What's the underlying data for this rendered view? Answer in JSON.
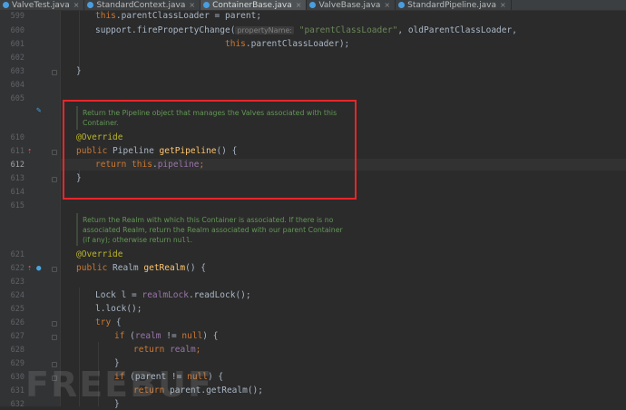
{
  "tabs": [
    {
      "label": "ValveTest.java",
      "active": false,
      "icon_color": "#4a9ede"
    },
    {
      "label": "StandardContext.java",
      "active": false,
      "icon_color": "#4a9ede"
    },
    {
      "label": "ContainerBase.java",
      "active": true,
      "icon_color": "#4a9ede"
    },
    {
      "label": "ValveBase.java",
      "active": false,
      "icon_color": "#4a9ede"
    },
    {
      "label": "StandardPipeline.java",
      "active": false,
      "icon_color": "#4a9ede"
    }
  ],
  "line_numbers": {
    "l599": "599",
    "l600": "600",
    "l601": "601",
    "l602": "602",
    "l603": "603",
    "l604": "604",
    "l605": "605",
    "l610": "610",
    "l611": "611",
    "l612": "612",
    "l613": "613",
    "l614": "614",
    "l615": "615",
    "l621": "621",
    "l622": "622",
    "l623": "623",
    "l624": "624",
    "l625": "625",
    "l626": "626",
    "l627": "627",
    "l628": "628",
    "l629": "629",
    "l630": "630",
    "l631": "631",
    "l632": "632"
  },
  "code": {
    "line599": {
      "this": "this",
      "rest": ".parentClassLoader = parent;"
    },
    "line600": {
      "pre": "support.firePropertyChange(",
      "hint": "propertyName:",
      "str": "\"parentClassLoader\"",
      "post": ", oldParentClassLoader,"
    },
    "line601": {
      "this": "this",
      "rest": ".parentClassLoader);"
    },
    "line603": "}",
    "doc1": "Return the Pipeline object that manages the Valves associated with this Container.",
    "line610": "@Override",
    "line611": {
      "kw": "public",
      "type": " Pipeline ",
      "fn": "getPipeline",
      "rest": "() {"
    },
    "line612": {
      "kw1": "return",
      "kw2": "this",
      "dot": ".",
      "fld": "pipeline",
      "end": ";"
    },
    "line613": "}",
    "doc2": "Return the Realm with which this Container is associated. If there is no associated Realm, return the Realm associated with our parent Container (if any); otherwise return",
    "doc2_code": "null",
    "doc2_end": ".",
    "line621": "@Override",
    "line622": {
      "kw": "public",
      "type": " Realm ",
      "fn": "getRealm",
      "rest": "() {"
    },
    "line624": {
      "pre": "Lock l = ",
      "fld": "realmLock",
      "post": ".readLock();"
    },
    "line625": "l.lock();",
    "line626": {
      "kw": "try",
      "rest": " {"
    },
    "line627": {
      "kw": "if",
      "pre": " (",
      "fld": "realm",
      "mid": " != ",
      "kw2": "null",
      "post": ") {"
    },
    "line628": {
      "kw": "return",
      "fld": "realm",
      "end": ";"
    },
    "line629": "}",
    "line630": {
      "kw": "if",
      "pre": " (parent != ",
      "kw2": "null",
      "post": ") {"
    },
    "line631": {
      "kw": "return",
      "rest": " parent.getRealm();"
    },
    "line632": "}"
  },
  "watermark": "FREEBUF",
  "colors": {
    "background": "#2b2b2b",
    "keyword": "#cc7832",
    "field": "#9876aa",
    "method": "#ffc66d",
    "annotation": "#bbb529",
    "string": "#6a8759",
    "doc": "#629755",
    "highlight_box": "#e8262a"
  }
}
